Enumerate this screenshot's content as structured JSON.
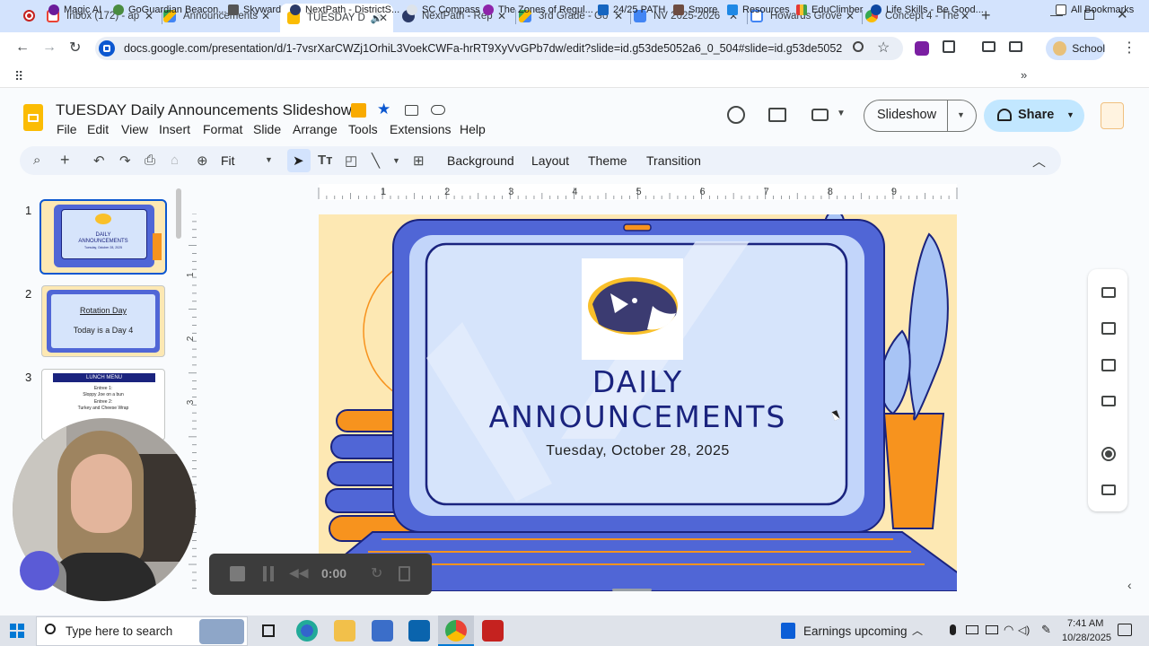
{
  "tabs": [
    {
      "label": "Inbox (172) - ap",
      "color": "#ea4335"
    },
    {
      "label": "Announcements",
      "color": "#34a853"
    },
    {
      "label": "TUESDAY D",
      "color": "#fbbc04"
    },
    {
      "label": "NextPath - Rep",
      "color": "#2b3a67"
    },
    {
      "label": "3rd Grade - Go",
      "color": "#34a853"
    },
    {
      "label": "NV 2025-2026",
      "color": "#4285f4"
    },
    {
      "label": "Howards Grove",
      "color": "#4285f4"
    },
    {
      "label": "Concept 4 - The",
      "color": "#ea4335"
    }
  ],
  "url": "docs.google.com/presentation/d/1-7vsrXarCWZj1OrhiL3VoekCWFa-hrRT9XyVvGPb7dw/edit?slide=id.g53de5052a6_0_504#slide=id.g53de5052a6_0_504",
  "profile": "School",
  "bookmarks": [
    "Magic AI",
    "GoGuardian Beacon...",
    "Skyward",
    "NextPath - DistrictS...",
    "SC Compass",
    "The Zones of Regul...",
    "24/25 PATH",
    "Smore",
    "Resources",
    "EduClimber",
    "Life Skills - Be Good...",
    "All Bookmarks"
  ],
  "doc": {
    "title": "TUESDAY Daily Announcements Slideshow"
  },
  "menus": [
    "File",
    "Edit",
    "View",
    "Insert",
    "Format",
    "Slide",
    "Arrange",
    "Tools",
    "Extensions",
    "Help"
  ],
  "toolbar": {
    "zoom": "Fit",
    "background": "Background",
    "layout": "Layout",
    "theme": "Theme",
    "transition": "Transition"
  },
  "header": {
    "slideshow": "Slideshow",
    "share": "Share"
  },
  "ruler": [
    "1",
    "2",
    "3",
    "4",
    "5",
    "6",
    "7",
    "8",
    "9"
  ],
  "vruler": [
    "1",
    "2",
    "3"
  ],
  "thumbs": [
    {
      "num": "1",
      "l1": "DAILY",
      "l2": "ANNOUNCEMENTS",
      "l3": "Tuesday, October 28, 2025"
    },
    {
      "num": "2",
      "l1": "Rotation Day",
      "l2": "Today is a Day 4"
    },
    {
      "num": "3",
      "l1": "LUNCH MENU",
      "l2": "Entree 1:",
      "l3": "Sloppy Joe on a bun",
      "l4": "Entree 2:",
      "l5": "Turkey and Cheese Wrap"
    }
  ],
  "slide": {
    "line1": "DAILY",
    "line2": "ANNOUNCEMENTS",
    "date": "Tuesday, October 28, 2025"
  },
  "recorder": {
    "time": "0:00"
  },
  "taskbar": {
    "search": "Type here to search",
    "news": "Earnings upcoming",
    "time": "7:41 AM",
    "date": "10/28/2025"
  },
  "colors": {
    "accent": "#0b57d0",
    "slidesYellow": "#fbbc04",
    "laptopBlue": "#5066d6",
    "orange": "#f7931e",
    "screen": "#d6e4fb"
  }
}
